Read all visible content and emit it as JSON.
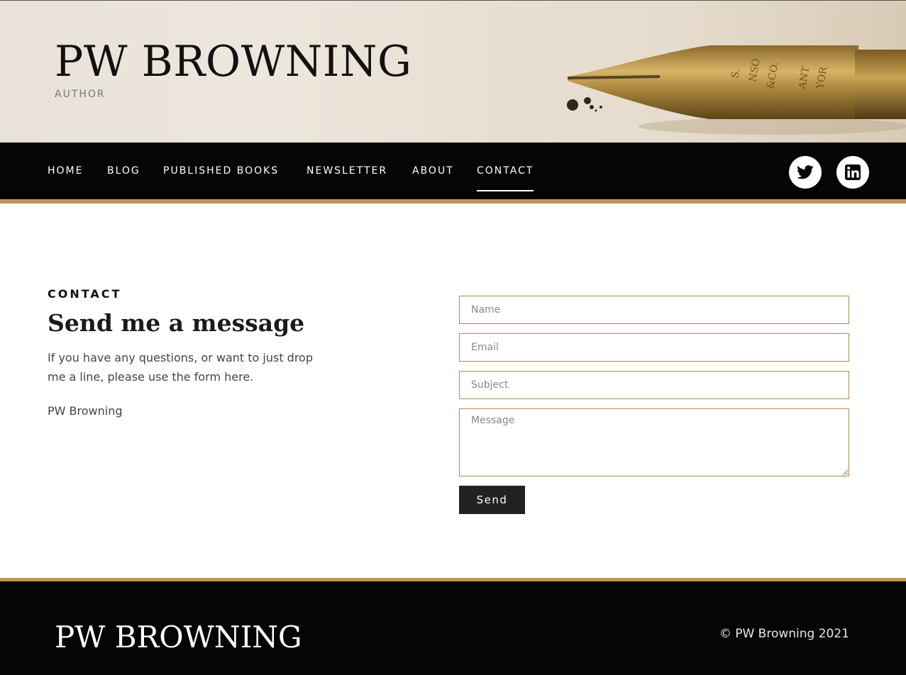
{
  "header": {
    "title": "PW BROWNING",
    "tagline": "AUTHOR"
  },
  "nav": {
    "items": [
      {
        "label": "HOME"
      },
      {
        "label": "BLOG"
      },
      {
        "label": "PUBLISHED BOOKS"
      },
      {
        "label": "NEWSLETTER"
      },
      {
        "label": "ABOUT"
      },
      {
        "label": "CONTACT",
        "active": true
      }
    ],
    "social": [
      {
        "icon": "twitter-icon"
      },
      {
        "icon": "linkedin-icon"
      }
    ]
  },
  "contact": {
    "kicker": "CONTACT",
    "heading": "Send me a message",
    "intro": "If you have any questions, or want to just drop me a line, please use the form here.",
    "signature": "PW Browning"
  },
  "form": {
    "name_placeholder": "Name",
    "email_placeholder": "Email",
    "subject_placeholder": "Subject",
    "message_placeholder": "Message",
    "send_label": "Send"
  },
  "footer": {
    "title": "PW BROWNING",
    "copyright": "© PW Browning 2021"
  },
  "colors": {
    "accent": "#c0945c",
    "field_border": "#b08a4c",
    "nav_bg": "#050505",
    "button_bg": "#222222"
  }
}
